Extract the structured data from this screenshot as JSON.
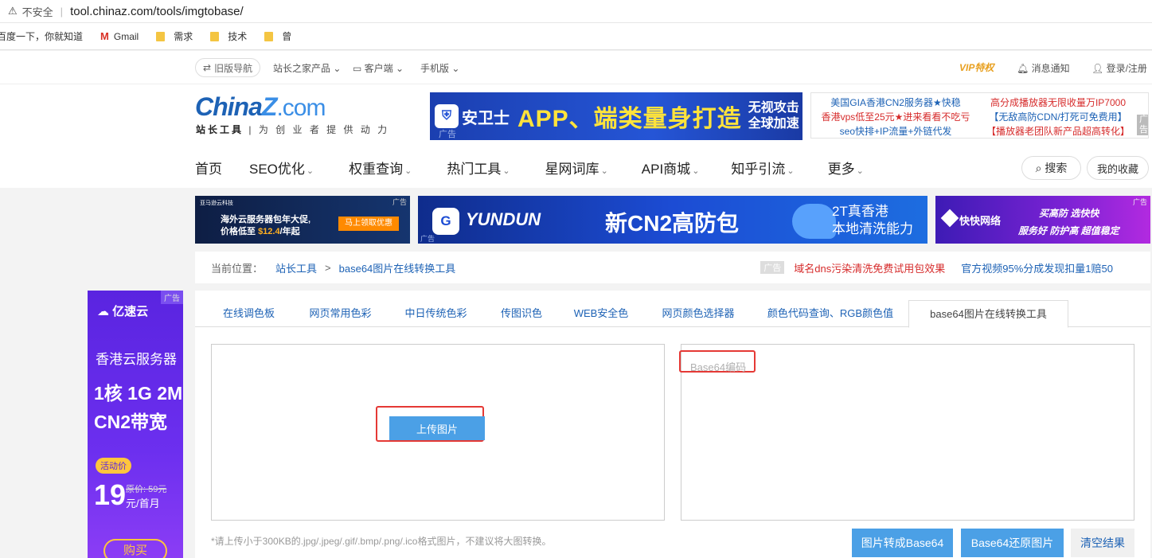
{
  "browser": {
    "warning_icon": "warning-icon",
    "insecure_label": "不安全",
    "url": "tool.chinaz.com/tools/imgtobase/",
    "bookmarks": [
      {
        "label": "百度一下，你就知道",
        "icon": ""
      },
      {
        "label": "Gmail",
        "icon": "gmail-icon"
      },
      {
        "label": "需求",
        "icon": "folder-icon"
      },
      {
        "label": "技术",
        "icon": "folder-icon"
      },
      {
        "label": "曾",
        "icon": "folder-icon"
      }
    ]
  },
  "topnav": {
    "old_nav": "旧版导航",
    "links": [
      "站长之家产品",
      "客户端",
      "手机版"
    ],
    "vip": "VIP特权",
    "notice": "消息通知",
    "login": "登录/注册"
  },
  "header": {
    "logo_main": "China",
    "logo_z": "Z",
    "logo_com": ".com",
    "logo_sub_bold": "站长工具",
    "logo_sub": "为 创 业 者 提 供 动 力",
    "ad_banner": {
      "brand": "安卫士",
      "headline": "APP、端类量身打造",
      "side_1": "无视攻击",
      "side_2": "全球加速",
      "tag": "广告"
    },
    "text_ads": {
      "left": [
        "美国GIA香港CN2服务器★快稳",
        "香港vps低至25元★进来看看不吃亏",
        "seo快排+IP流量+外链代发"
      ],
      "right": [
        "高分成播放器无限收量万IP7000",
        "【无敌高防CDN/打死可免费用】",
        "【播放器老团队新产品超高转化】"
      ],
      "tag": "广告"
    },
    "nav": [
      "首页",
      "SEO优化",
      "权重查询",
      "热门工具",
      "星网词库",
      "API商城",
      "知乎引流",
      "更多"
    ],
    "search": "搜索",
    "favorites": "我的收藏"
  },
  "ads_row": {
    "a": {
      "brand": "亚马逊云科技",
      "line1": "海外云服务器包年大促,",
      "line2": "价格低至",
      "price": "$12.4",
      "unit": "/年起",
      "cta": "马上领取优惠",
      "tag": "广告"
    },
    "b": {
      "brand": "YUNDUN",
      "headline": "新CN2高防包",
      "right_1": "2T真香港",
      "right_2": "本地清洗能力",
      "tag": "广告"
    },
    "c": {
      "brand": "快快网络",
      "line1": "买高防 选快快",
      "line2": "服务好 防护高 超值稳定",
      "tag": "广告"
    }
  },
  "breadcrumb": {
    "prefix": "当前位置：",
    "home": "站长工具",
    "sep": ">",
    "current": "base64图片在线转换工具",
    "ad_tag": "广告",
    "ad_red": "域名dns污染清洗免费试用包效果",
    "ad_blue": "官方视频95%分成发现扣量1赔50"
  },
  "side_ad": {
    "brand": "亿速云",
    "tag": "广告",
    "line1": "香港云服务器",
    "line2": "1核 1G 2M",
    "line3": "CN2带宽",
    "promo": "活动价",
    "price": "19",
    "orig": "原价: 59元",
    "unit": "元/首月",
    "buy": "购买"
  },
  "tool": {
    "tabs": [
      "在线调色板",
      "网页常用色彩",
      "中日传统色彩",
      "传图识色",
      "WEB安全色",
      "网页颜色选择器",
      "颜色代码查询、RGB颜色值",
      "base64图片在线转换工具"
    ],
    "active_tab": 7,
    "upload_button": "上传图片",
    "output_placeholder": "Base64编码",
    "note": "*请上传小于300KB的.jpg/.jpeg/.gif/.bmp/.png/.ico格式图片，不建议将大图转换。",
    "btn_to_base64": "图片转成Base64",
    "btn_restore": "Base64还原图片",
    "btn_clear": "清空结果"
  }
}
